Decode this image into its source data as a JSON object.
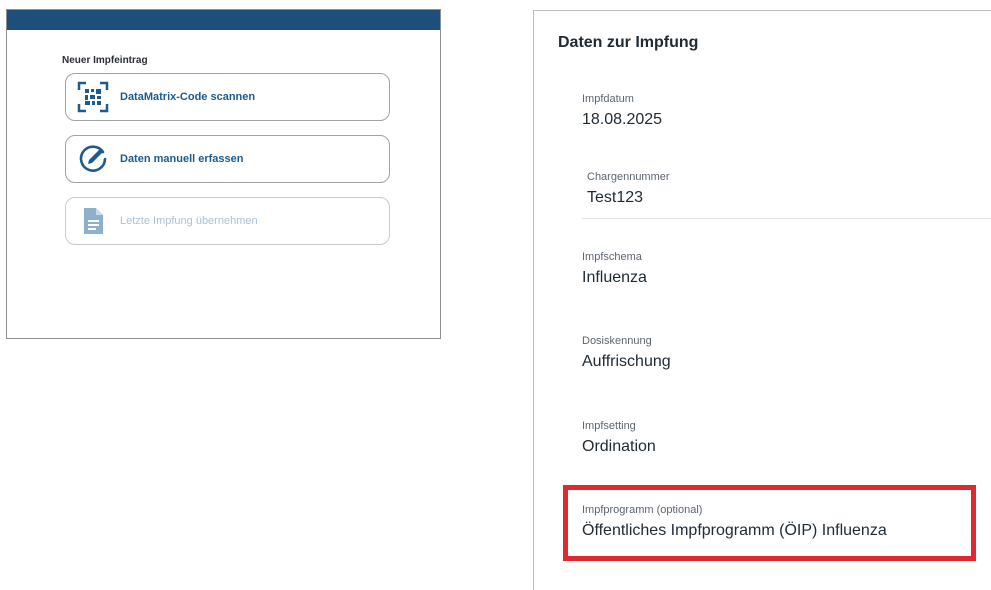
{
  "left": {
    "heading": "Neuer Impfeintrag",
    "buttons": [
      {
        "label": "DataMatrix-Code scannen",
        "icon": "qr-scan-icon",
        "enabled": true
      },
      {
        "label": "Daten manuell erfassen",
        "icon": "pencil-icon",
        "enabled": true
      },
      {
        "label": "Letzte Impfung übernehmen",
        "icon": "document-icon",
        "enabled": false
      }
    ]
  },
  "right": {
    "title": "Daten zur Impfung",
    "fields": [
      {
        "label": "Impfdatum",
        "value": "18.08.2025"
      },
      {
        "label": "Chargennummer",
        "value": "Test123"
      },
      {
        "label": "Impfschema",
        "value": "Influenza"
      },
      {
        "label": "Dosiskennung",
        "value": "Auffrischung"
      },
      {
        "label": "Impfsetting",
        "value": "Ordination"
      },
      {
        "label": "Impfprogramm (optional)",
        "value": "Öffentliches Impfprogramm (ÖIP) Influenza"
      }
    ]
  },
  "colors": {
    "topbar": "#1e4f7a",
    "primary_text": "#1d5b8f",
    "disabled_text": "#a9c2d8",
    "highlight": "#e0282f"
  }
}
